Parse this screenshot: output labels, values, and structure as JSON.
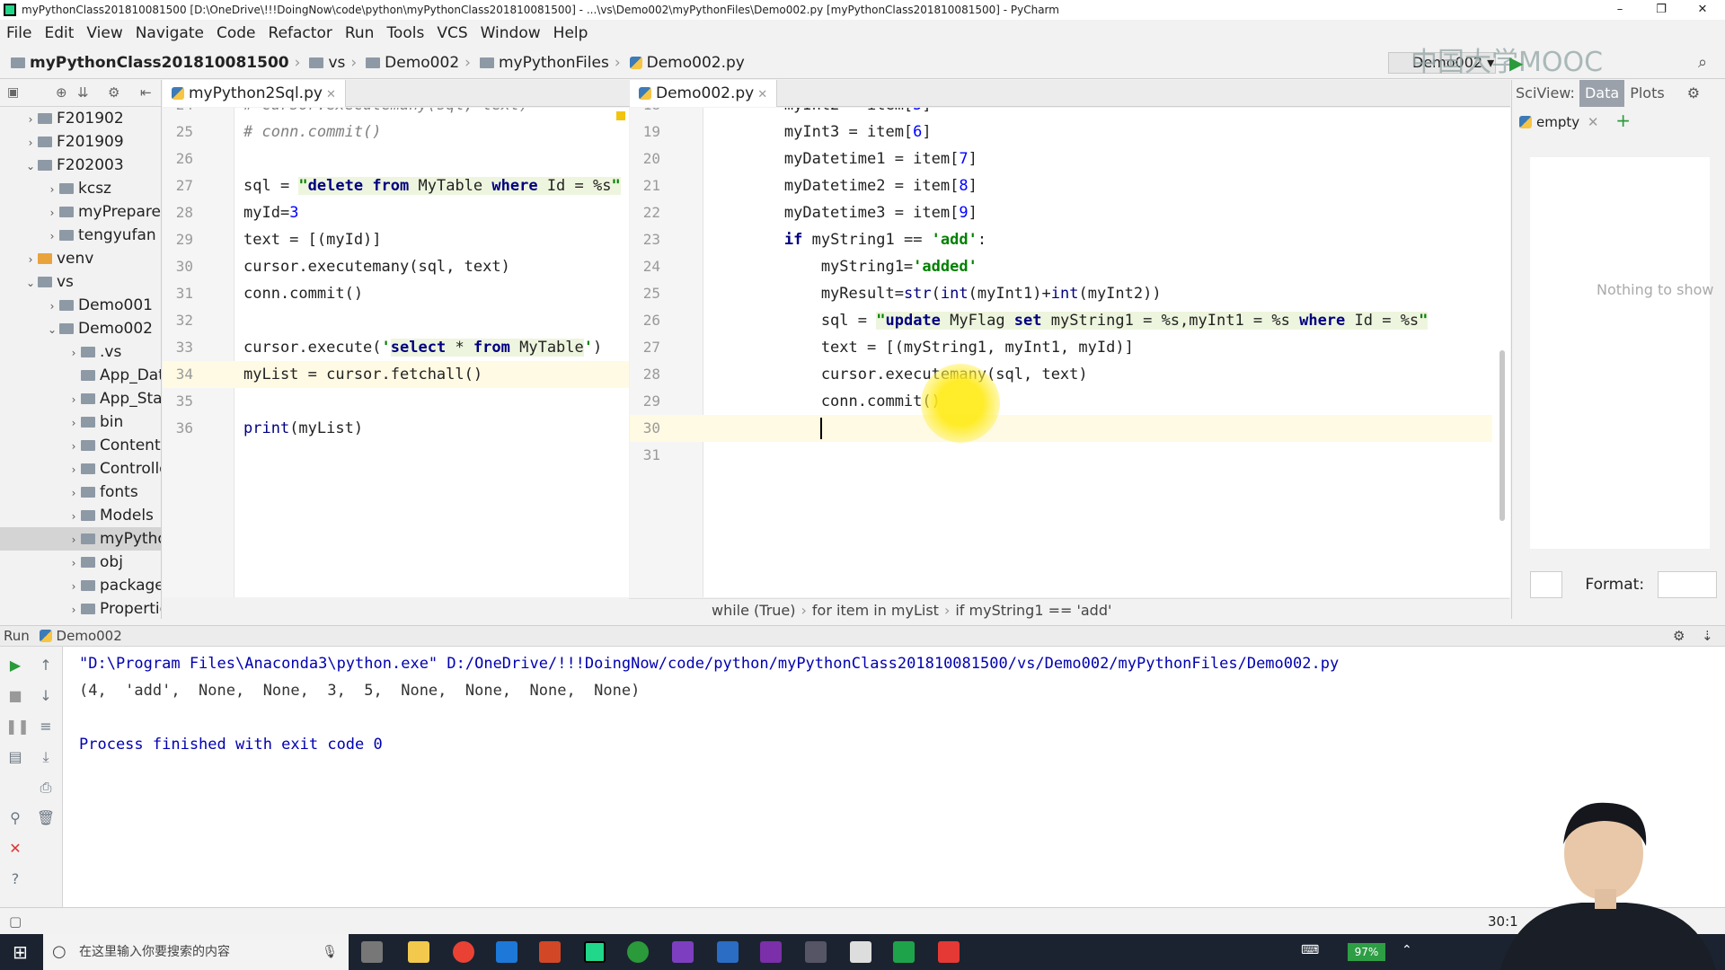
{
  "window": {
    "title": "myPythonClass201810081500 [D:\\OneDrive\\!!!DoingNow\\code\\python\\myPythonClass201810081500] - ...\\vs\\Demo002\\myPythonFiles\\Demo002.py [myPythonClass201810081500] - PyCharm",
    "minimize": "–",
    "maximize": "❐",
    "close": "✕"
  },
  "menu": [
    "File",
    "Edit",
    "View",
    "Navigate",
    "Code",
    "Refactor",
    "Run",
    "Tools",
    "VCS",
    "Window",
    "Help"
  ],
  "nav": {
    "project": "myPythonClass201810081500",
    "crumbs": [
      "vs",
      "Demo002",
      "myPythonFiles",
      "Demo002.py"
    ],
    "run_config": "Demo002",
    "watermark": "中国大学MOOC"
  },
  "project_tree": [
    {
      "label": "F201902",
      "state": "collapsed"
    },
    {
      "label": "F201909",
      "state": "collapsed"
    },
    {
      "label": "F202003",
      "state": "expanded"
    },
    {
      "label": "kcsz",
      "state": "collapsed"
    },
    {
      "label": "myPrepare",
      "state": "collapsed"
    },
    {
      "label": "tengyufan",
      "state": "collapsed"
    },
    {
      "label": "venv",
      "state": "collapsed"
    },
    {
      "label": "vs",
      "state": "expanded"
    },
    {
      "label": "Demo001",
      "state": "collapsed"
    },
    {
      "label": "Demo002",
      "state": "expanded"
    },
    {
      "label": ".vs",
      "state": "collapsed"
    },
    {
      "label": "App_Data",
      "state": "none"
    },
    {
      "label": "App_Start",
      "state": "collapsed"
    },
    {
      "label": "bin",
      "state": "collapsed"
    },
    {
      "label": "Content",
      "state": "collapsed"
    },
    {
      "label": "Controllers",
      "state": "collapsed"
    },
    {
      "label": "fonts",
      "state": "collapsed"
    },
    {
      "label": "Models",
      "state": "collapsed"
    },
    {
      "label": "myPythonFiles",
      "state": "collapsed",
      "selected": true
    },
    {
      "label": "obj",
      "state": "collapsed"
    },
    {
      "label": "packages",
      "state": "collapsed"
    },
    {
      "label": "Properties",
      "state": "collapsed"
    }
  ],
  "left_editor": {
    "tab": "myPython2Sql.py",
    "line_numbers": [
      "24",
      "25",
      "26",
      "27",
      "28",
      "29",
      "30",
      "31",
      "32",
      "33",
      "34",
      "35",
      "36"
    ]
  },
  "right_editor": {
    "tab": "Demo002.py",
    "line_numbers": [
      "18",
      "19",
      "20",
      "21",
      "22",
      "23",
      "24",
      "25",
      "26",
      "27",
      "28",
      "29",
      "30",
      "31"
    ],
    "breadcrumb": [
      "while (True)",
      "for item in myList",
      "if myString1 == 'add'"
    ]
  },
  "sciview": {
    "title": "SciView:",
    "tabs": [
      "Data",
      "Plots"
    ],
    "subtab": "empty",
    "empty_text": "Nothing to show",
    "format_label": "Format:"
  },
  "run": {
    "title": "Run",
    "config": "Demo002",
    "output": [
      "\"D:\\Program Files\\Anaconda3\\python.exe\" D:/OneDrive/!!!DoingNow/code/python/myPythonClass201810081500/vs/Demo002/myPythonFiles/Demo002.py",
      "(4,  'add',  None,  None,  3,  5,  None,  None,  None,  None)",
      "",
      "Process finished with exit code 0"
    ]
  },
  "status": {
    "position": "30:1"
  },
  "taskbar": {
    "search_placeholder": "在这里输入你要搜索的内容",
    "battery": "97%"
  },
  "colors": {
    "keyword": "#000080",
    "string": "#008000",
    "number": "#0000ff",
    "comment": "#808080",
    "highlight": "#fff200"
  }
}
